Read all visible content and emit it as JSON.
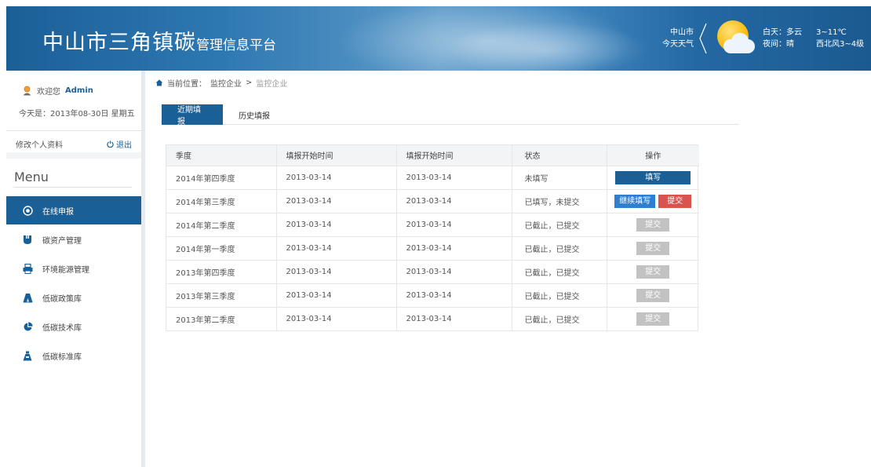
{
  "header": {
    "title_big": "中山市三角镇碳",
    "title_small": "管理信息平台",
    "weather": {
      "city": "中山市",
      "label": "今天天气",
      "day": "白天：多云",
      "night": "夜间：晴",
      "temp": "3~11℃",
      "wind": "西北风3~4级"
    }
  },
  "sidebar": {
    "welcome": "欢迎您",
    "user": "Admin",
    "today": "今天是：2013年08-30日  星期五",
    "profile_link": "修改个人资料",
    "logout": "退出",
    "menu_title": "Menu",
    "items": [
      {
        "label": "在线申报",
        "icon": "target-icon",
        "active": true
      },
      {
        "label": "碳资产管理",
        "icon": "cup-icon",
        "active": false
      },
      {
        "label": "环境能源管理",
        "icon": "printer-icon",
        "active": false
      },
      {
        "label": "低碳政策库",
        "icon": "road-icon",
        "active": false
      },
      {
        "label": "低碳技术库",
        "icon": "pie-icon",
        "active": false
      },
      {
        "label": "低碳标准库",
        "icon": "flask-icon",
        "active": false
      }
    ]
  },
  "breadcrumb": {
    "prefix": "当前位置：",
    "parent": "监控企业",
    "separator": ">",
    "current": "监控企业"
  },
  "tabs": [
    {
      "label": "近期填报",
      "active": true
    },
    {
      "label": "历史填报",
      "active": false
    }
  ],
  "table": {
    "headers": [
      "季度",
      "填报开始时间",
      "填报开始时间",
      "状态",
      "操作"
    ],
    "rows": [
      {
        "quarter": "2014年第四季度",
        "start": "2013-03-14",
        "start2": "2013-03-14",
        "status": "未填写",
        "actions": [
          "填写"
        ]
      },
      {
        "quarter": "2014年第三季度",
        "start": "2013-03-14",
        "start2": "2013-03-14",
        "status": "已填写，未提交",
        "actions": [
          "继续填写",
          "提交"
        ]
      },
      {
        "quarter": "2014年第二季度",
        "start": "2013-03-14",
        "start2": "2013-03-14",
        "status": "已截止，已提交",
        "actions": [
          "提交"
        ]
      },
      {
        "quarter": "2014年第一季度",
        "start": "2013-03-14",
        "start2": "2013-03-14",
        "status": "已截止，已提交",
        "actions": [
          "提交"
        ]
      },
      {
        "quarter": "2013年第四季度",
        "start": "2013-03-14",
        "start2": "2013-03-14",
        "status": "已截止，已提交",
        "actions": [
          "提交"
        ]
      },
      {
        "quarter": "2013年第三季度",
        "start": "2013-03-14",
        "start2": "2013-03-14",
        "status": "已截止，已提交",
        "actions": [
          "提交"
        ]
      },
      {
        "quarter": "2013年第二季度",
        "start": "2013-03-14",
        "start2": "2013-03-14",
        "status": "已截止，已提交",
        "actions": [
          "提交"
        ]
      }
    ]
  },
  "colors": {
    "primary": "#1b5f97",
    "continue": "#2f7fd0",
    "submit": "#d9534f",
    "disabled": "#c2c2c2"
  }
}
